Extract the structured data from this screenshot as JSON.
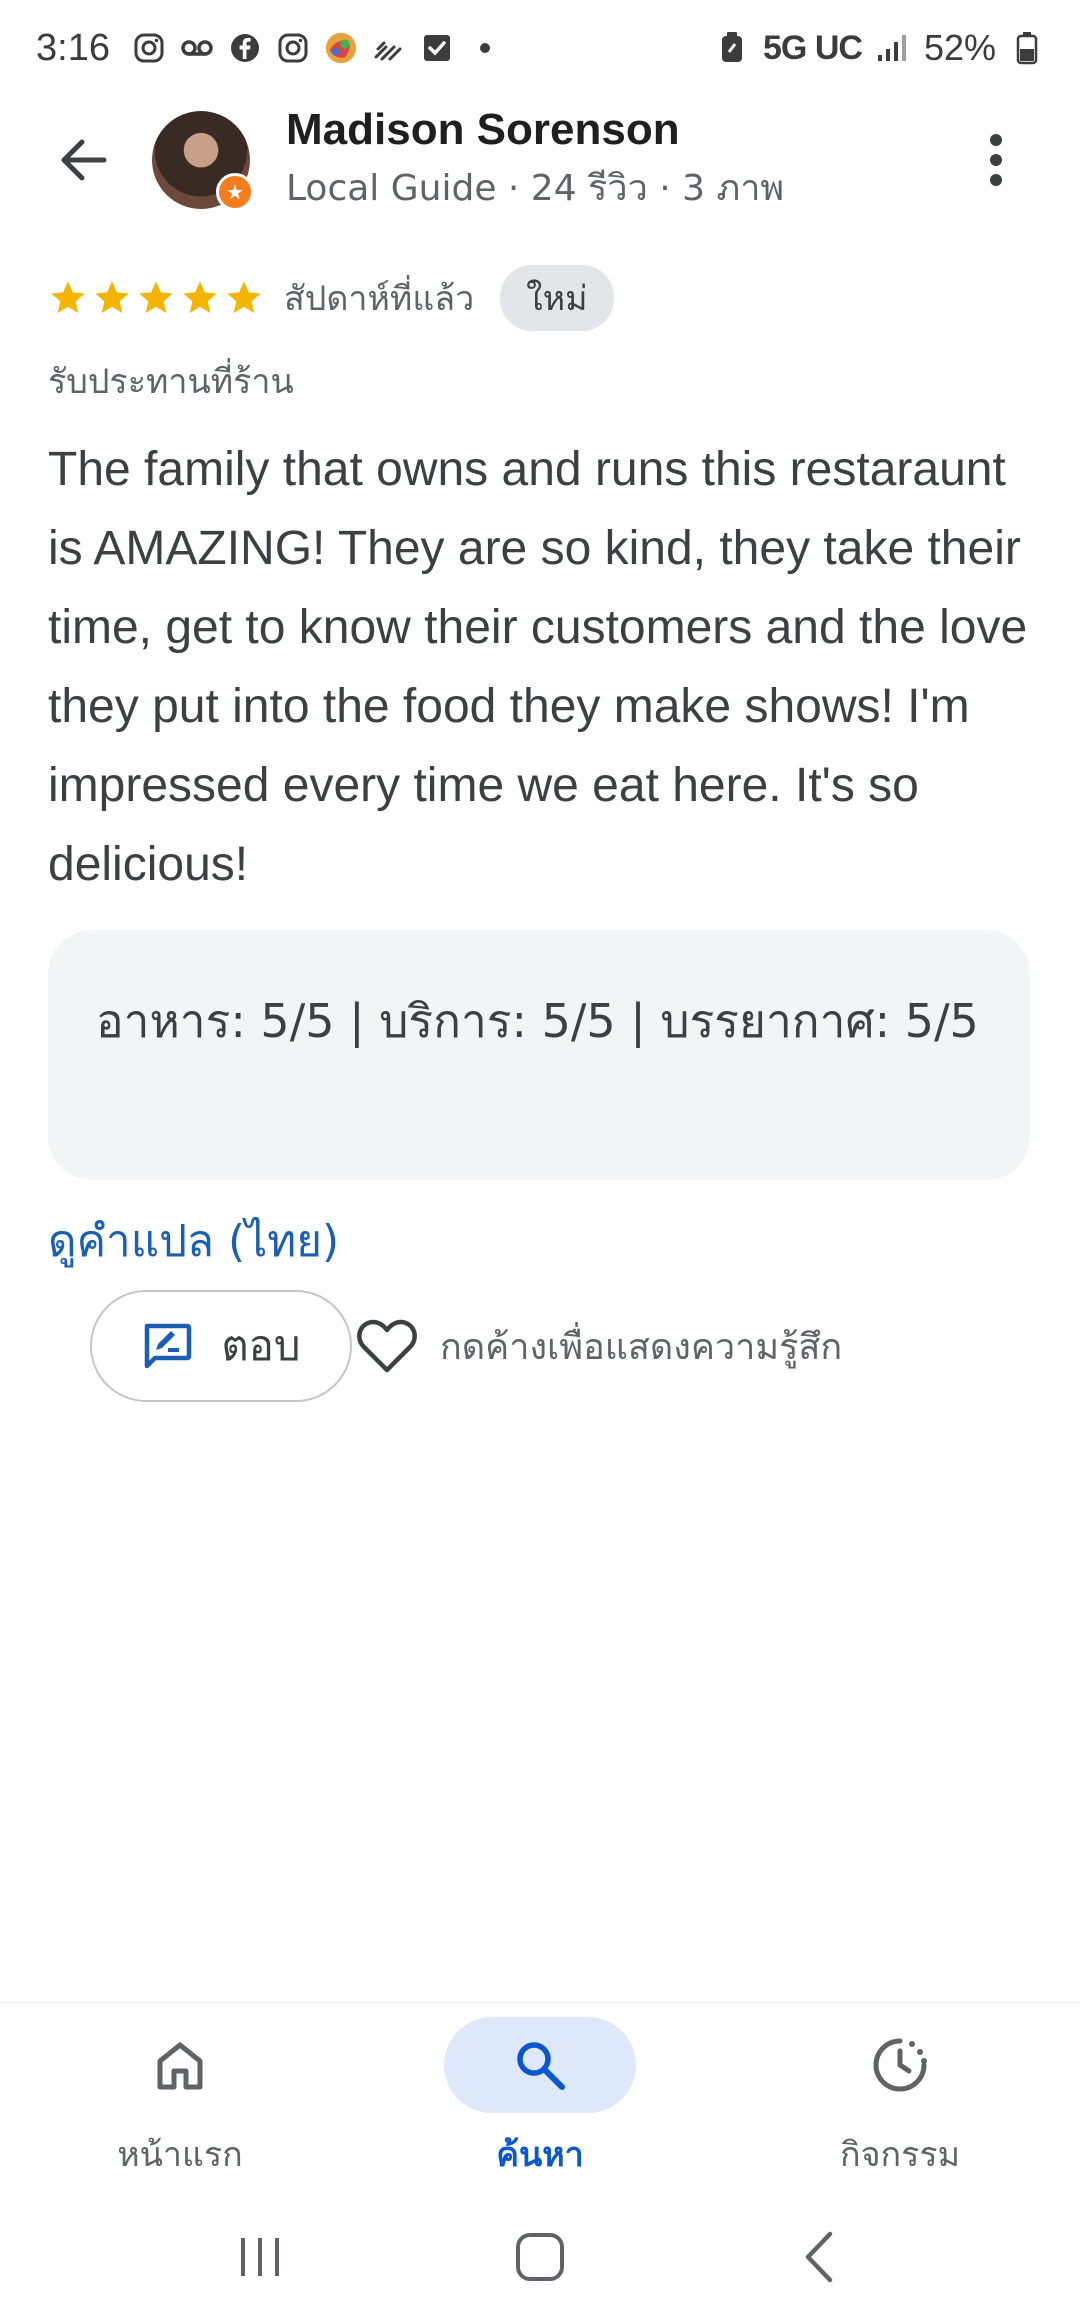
{
  "status_bar": {
    "time": "3:16",
    "network": "5G UC",
    "battery": "52%",
    "left_icons": [
      "instagram-icon",
      "voicemail-icon",
      "facebook-icon",
      "instagram-icon",
      "app-icon",
      "wifi-calling-icon",
      "checkbox-icon",
      "dot-icon"
    ]
  },
  "header": {
    "name": "Madison Sorenson",
    "meta": "Local Guide · 24 รีวิว · 3 ภาพ"
  },
  "review": {
    "stars": 5,
    "date": "สัปดาห์ที่แล้ว",
    "badge": "ใหม่",
    "visit_type": "รับประทานที่ร้าน",
    "text": "The family that owns and runs this restaraunt is AMAZING! They are so kind, they take their time, get to know their customers and the love they put into the food they make shows! I'm impressed every time we eat here. It's so delicious!",
    "ratings": "อาหาร: 5/5 | บริการ: 5/5 | บรรยากาศ: 5/5",
    "translate_link": "ดูคำแปล (ไทย)",
    "reply_label": "ตอบ",
    "like_hint": "กดค้างเพื่อแสดงความรู้สึก"
  },
  "bottom_nav": {
    "items": [
      {
        "label": "หน้าแรก",
        "icon": "home-icon",
        "active": false
      },
      {
        "label": "ค้นหา",
        "icon": "search-icon",
        "active": true
      },
      {
        "label": "กิจกรรม",
        "icon": "activity-icon",
        "active": false
      }
    ]
  },
  "colors": {
    "star": "#f4b400",
    "link": "#1a5fb4",
    "active_nav": "#0b57d0",
    "active_nav_bg": "#dde8fb",
    "badge_bg": "#e3e5e8",
    "ratings_bg": "#f3f4f6"
  }
}
